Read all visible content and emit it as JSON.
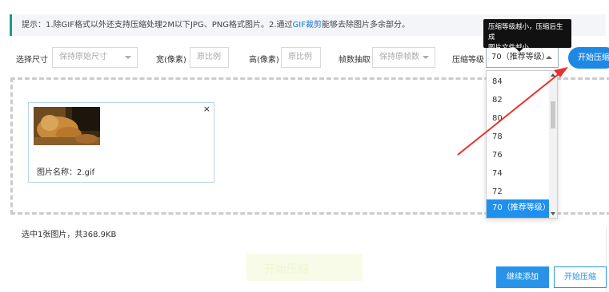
{
  "tip": {
    "prefix": "提示：1.除GIF格式以外还支持压缩处理2M以下JPG、PNG格式图片。2.通过",
    "link": "GIF裁剪",
    "suffix": "能够去除图片多余部分。"
  },
  "tooltip": {
    "line1": "压缩等级越小，压缩后生成",
    "line2": "图片文件越小。"
  },
  "options": {
    "size_label": "选择尺寸",
    "size_value": "保持原始尺寸",
    "width_label": "宽(像素)",
    "width_placeholder": "原比例",
    "height_label": "高(像素)",
    "height_placeholder": "原比例",
    "frames_label": "帧数抽取",
    "frames_value": "保持原帧数",
    "level_label": "压缩等级",
    "level_value": "70（推荐等级）"
  },
  "start_button_top": "开始压缩",
  "card": {
    "close": "×",
    "filename": "图片名称：2.gif"
  },
  "dropdown": {
    "items": [
      "84",
      "82",
      "80",
      "78",
      "76",
      "74",
      "72",
      "70（推荐等级）"
    ],
    "selected_index": 7
  },
  "summary": "选中1张图片，共368.9KB",
  "ghost_text": "开始压缩",
  "buttons": {
    "continue": "继续添加",
    "start": "开始压缩"
  },
  "colors": {
    "accent": "#1e88e5",
    "arrow": "#e8302a",
    "tip_border": "#1b9a8c"
  }
}
